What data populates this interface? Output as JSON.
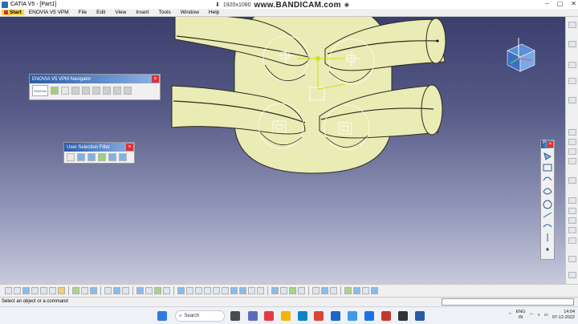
{
  "window": {
    "title": "CATIA V5 - [Part1]",
    "controls": [
      "–",
      "▢",
      "✕"
    ]
  },
  "recorder": {
    "resolution": "1920x1080",
    "brand": "www.BANDICAM.com"
  },
  "menubar": {
    "items": [
      "Start",
      "ENOVIA V5 VPM",
      "File",
      "Edit",
      "View",
      "Insert",
      "Tools",
      "Window",
      "Help"
    ]
  },
  "enovia_toolbar": {
    "title": "ENOVIA V5 VPM Navigator",
    "logo_text": "ENOVIA",
    "close": "×"
  },
  "usf_toolbar": {
    "title": "User Selection Filter",
    "close": "×"
  },
  "right_toolbar": {
    "title": "P",
    "close": "×"
  },
  "statusbar": {
    "text": "Select an object or a command"
  },
  "taskbar": {
    "search_label": "Search",
    "language": [
      "ENG",
      "IN"
    ],
    "time": "14:04",
    "date": "07-12-2022"
  },
  "colors": {
    "part_fill": "#e9ecb4",
    "part_stroke": "#2b2b1e",
    "background_top": "#3b3f6e",
    "background_bottom": "#c7cadc",
    "highlight_green": "#c8e21a"
  }
}
